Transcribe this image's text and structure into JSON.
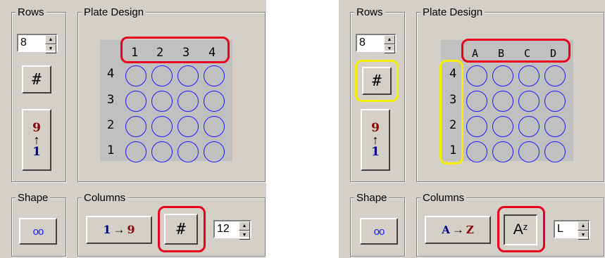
{
  "left": {
    "rows_group": {
      "label": "Rows",
      "spin_value": "8",
      "number_button": "#",
      "order_top": "9",
      "order_arrow": "↑",
      "order_bottom": "1"
    },
    "plate_group": {
      "label": "Plate Design",
      "col_headers": [
        "1",
        "2",
        "3",
        "4"
      ],
      "row_headers": [
        "4",
        "3",
        "2",
        "1"
      ]
    },
    "shape_group": {
      "label": "Shape",
      "shape_button": "oo"
    },
    "columns_group": {
      "label": "Columns",
      "order_from": "1",
      "order_arrow": "→",
      "order_to": "9",
      "type_button": "#",
      "spin_value": "12"
    }
  },
  "right": {
    "rows_group": {
      "label": "Rows",
      "spin_value": "8",
      "number_button": "#",
      "order_top": "9",
      "order_arrow": "↑",
      "order_bottom": "1"
    },
    "plate_group": {
      "label": "Plate Design",
      "col_headers": [
        "A",
        "B",
        "C",
        "D"
      ],
      "row_headers": [
        "4",
        "3",
        "2",
        "1"
      ]
    },
    "shape_group": {
      "label": "Shape",
      "shape_button": "oo"
    },
    "columns_group": {
      "label": "Columns",
      "order_from": "A",
      "order_arrow": "→",
      "order_to": "Z",
      "type_button": "A",
      "type_button_sup": "z",
      "spin_value": "L"
    }
  },
  "colors": {
    "panel_bg": "#d4d0c8",
    "plate_bg": "#c0c0c0",
    "well_border": "#1a1aff",
    "highlight_red": "#e8001c",
    "highlight_yellow": "#f5f000",
    "nine": "#8b0000",
    "one": "#00008b"
  }
}
